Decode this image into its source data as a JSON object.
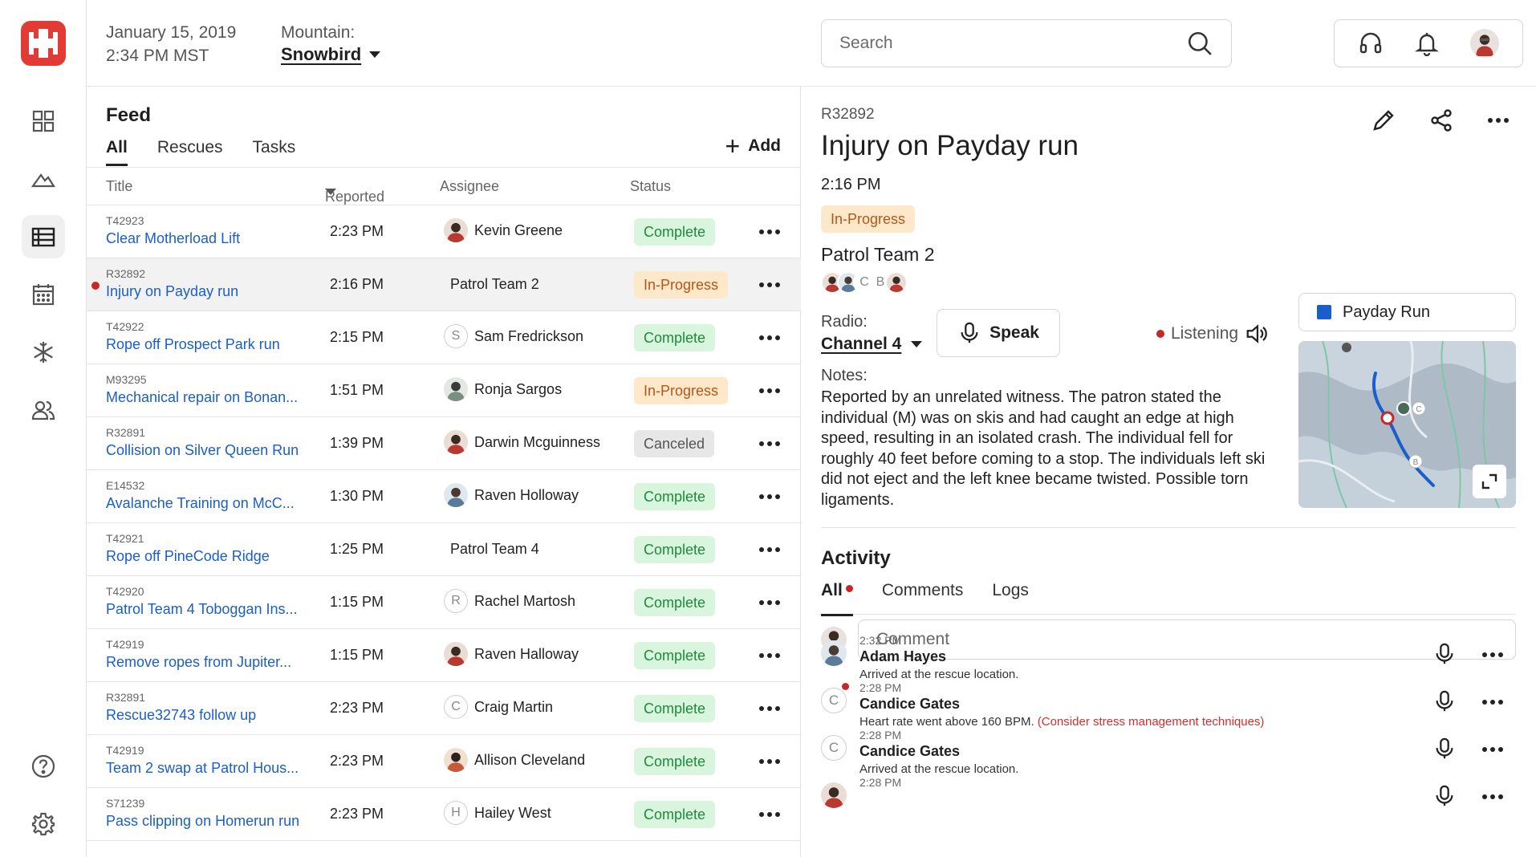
{
  "colors": {
    "brand": "#e23b35",
    "link": "#1a5ecc",
    "complete_bg": "#d9f5de",
    "complete_fg": "#1f8a3b",
    "progress_bg": "#fde9c9",
    "progress_fg": "#b5551b",
    "canceled_bg": "#e7e7e7",
    "alert": "#c62828"
  },
  "rail": {
    "logo": "plus-cross-logo",
    "items": [
      {
        "icon": "dashboard-icon"
      },
      {
        "icon": "mountain-icon"
      },
      {
        "icon": "list-icon",
        "active": true
      },
      {
        "icon": "calendar-icon"
      },
      {
        "icon": "snowflake-icon"
      },
      {
        "icon": "people-icon"
      },
      {
        "icon": "help-icon"
      },
      {
        "icon": "gear-icon"
      }
    ]
  },
  "header": {
    "date": "January 15, 2019",
    "time": "2:34 PM MST",
    "mountain_label": "Mountain:",
    "mountain_value": "Snowbird",
    "search_placeholder": "Search",
    "icons": [
      "headset-icon",
      "bell-icon",
      "user-avatar"
    ]
  },
  "feed": {
    "title": "Feed",
    "tabs": [
      "All",
      "Rescues",
      "Tasks"
    ],
    "add_label": "Add",
    "columns": {
      "title": "Title",
      "reported": "Reported",
      "assignee": "Assignee",
      "status": "Status"
    },
    "rows": [
      {
        "id": "T42923",
        "title": "Clear Motherload Lift",
        "time": "2:23 PM",
        "assignee": "Kevin Greene",
        "avatar": "photo",
        "status": "Complete"
      },
      {
        "id": "R32892",
        "title": "Injury on Payday run",
        "time": "2:16 PM",
        "assignee": "Patrol Team 2",
        "avatar": "none",
        "status": "In-Progress",
        "selected": true,
        "unread": true
      },
      {
        "id": "T42922",
        "title": "Rope off Prospect Park run",
        "time": "2:15 PM",
        "assignee": "Sam Fredrickson",
        "avatar": "S",
        "status": "Complete"
      },
      {
        "id": "M93295",
        "title": "Mechanical repair on Bonan...",
        "time": "1:51 PM",
        "assignee": "Ronja Sargos",
        "avatar": "photo",
        "status": "In-Progress"
      },
      {
        "id": "R32891",
        "title": "Collision on Silver Queen Run",
        "time": "1:39 PM",
        "assignee": "Darwin Mcguinness",
        "avatar": "photo",
        "status": "Canceled"
      },
      {
        "id": "E14532",
        "title": "Avalanche Training on McC...",
        "time": "1:30 PM",
        "assignee": "Raven Holloway",
        "avatar": "photo",
        "status": "Complete"
      },
      {
        "id": "T42921",
        "title": "Rope off PineCode Ridge",
        "time": "1:25 PM",
        "assignee": "Patrol Team 4",
        "avatar": "none",
        "status": "Complete"
      },
      {
        "id": "T42920",
        "title": "Patrol Team 4 Toboggan Ins...",
        "time": "1:15 PM",
        "assignee": "Rachel Martosh",
        "avatar": "R",
        "status": "Complete"
      },
      {
        "id": "T42919",
        "title": "Remove ropes from Jupiter...",
        "time": "1:15 PM",
        "assignee": "Raven Halloway",
        "avatar": "photo",
        "status": "Complete"
      },
      {
        "id": "R32891",
        "title": "Rescue32743 follow up",
        "time": "2:23 PM",
        "assignee": "Craig Martin",
        "avatar": "C",
        "status": "Complete"
      },
      {
        "id": "T42919",
        "title": "Team 2 swap at Patrol Hous...",
        "time": "2:23 PM",
        "assignee": "Allison Cleveland",
        "avatar": "photo",
        "status": "Complete"
      },
      {
        "id": "S71239",
        "title": "Pass clipping on Homerun run",
        "time": "2:23 PM",
        "assignee": "Hailey West",
        "avatar": "H",
        "status": "Complete"
      }
    ]
  },
  "detail": {
    "id": "R32892",
    "title": "Injury on Payday run",
    "time": "2:16 PM",
    "status": "In-Progress",
    "team": "Patrol Team 2",
    "team_avatars": [
      "photo",
      "photo",
      "C",
      "B",
      "photo"
    ],
    "radio_label": "Radio:",
    "channel": "Channel 4",
    "speak_label": "Speak",
    "listening_label": "Listening",
    "notes_label": "Notes:",
    "notes": "Reported by an unrelated witness. The patron stated the individual (M) was on skis and had caught an edge at high speed, resulting in an isolated crash. The individual fell for roughly 40 feet before coming to a stop. The individuals left ski did not eject and the left knee became twisted. Possible torn ligaments.",
    "map_title": "Payday Run",
    "map_markers": [
      "C",
      "B"
    ],
    "activity": {
      "title": "Activity",
      "tabs": [
        "All",
        "Comments",
        "Logs"
      ],
      "comment_placeholder": "Comment",
      "logs": [
        {
          "time": "2:32 PM",
          "name": "Adam Hayes",
          "text": "Arrived at the rescue location.",
          "warning": "",
          "avatar": "photo"
        },
        {
          "time": "2:28 PM",
          "name": "Candice Gates",
          "text": "Heart rate went above 160 BPM.",
          "warning": "(Consider stress management techniques)",
          "avatar": "C",
          "unread": true
        },
        {
          "time": "2:28 PM",
          "name": "Candice Gates",
          "text": "Arrived at the rescue location.",
          "warning": "",
          "avatar": "C"
        },
        {
          "time": "2:28 PM",
          "name": "",
          "text": "",
          "warning": "",
          "avatar": "photo"
        }
      ]
    }
  }
}
